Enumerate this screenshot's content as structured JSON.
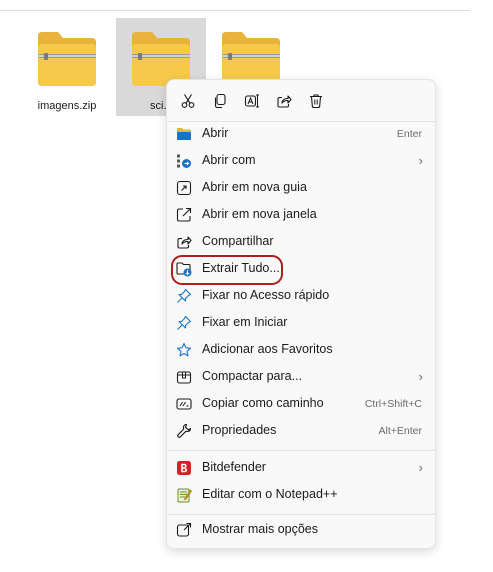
{
  "files": [
    {
      "name": "imagens.zip",
      "selected": false
    },
    {
      "name": "sci.z",
      "selected": true
    },
    {
      "name": "",
      "selected": false
    }
  ],
  "quick_actions": [
    "cut-icon",
    "copy-icon",
    "rename-icon",
    "share-icon",
    "delete-icon"
  ],
  "menu": {
    "open": {
      "label": "Abrir",
      "shortcut": "Enter"
    },
    "open_with": {
      "label": "Abrir com"
    },
    "open_new_tab": {
      "label": "Abrir em nova guia"
    },
    "open_new_window": {
      "label": "Abrir em nova janela"
    },
    "share": {
      "label": "Compartilhar"
    },
    "extract_all": {
      "label": "Extrair Tudo..."
    },
    "pin_quick_access": {
      "label": "Fixar no Acesso rápido"
    },
    "pin_start": {
      "label": "Fixar em Iniciar"
    },
    "add_favorites": {
      "label": "Adicionar aos Favoritos"
    },
    "compress_to": {
      "label": "Compactar para..."
    },
    "copy_as_path": {
      "label": "Copiar como caminho",
      "shortcut": "Ctrl+Shift+C"
    },
    "properties": {
      "label": "Propriedades",
      "shortcut": "Alt+Enter"
    },
    "bitdefender": {
      "label": "Bitdefender"
    },
    "edit_notepad": {
      "label": "Editar com o Notepad++"
    },
    "more_options": {
      "label": "Mostrar mais opções"
    }
  },
  "colors": {
    "folder": "#f6c94c",
    "accent": "#1a73c8",
    "bitdefender": "#d62128",
    "highlight": "#b01e1e"
  }
}
